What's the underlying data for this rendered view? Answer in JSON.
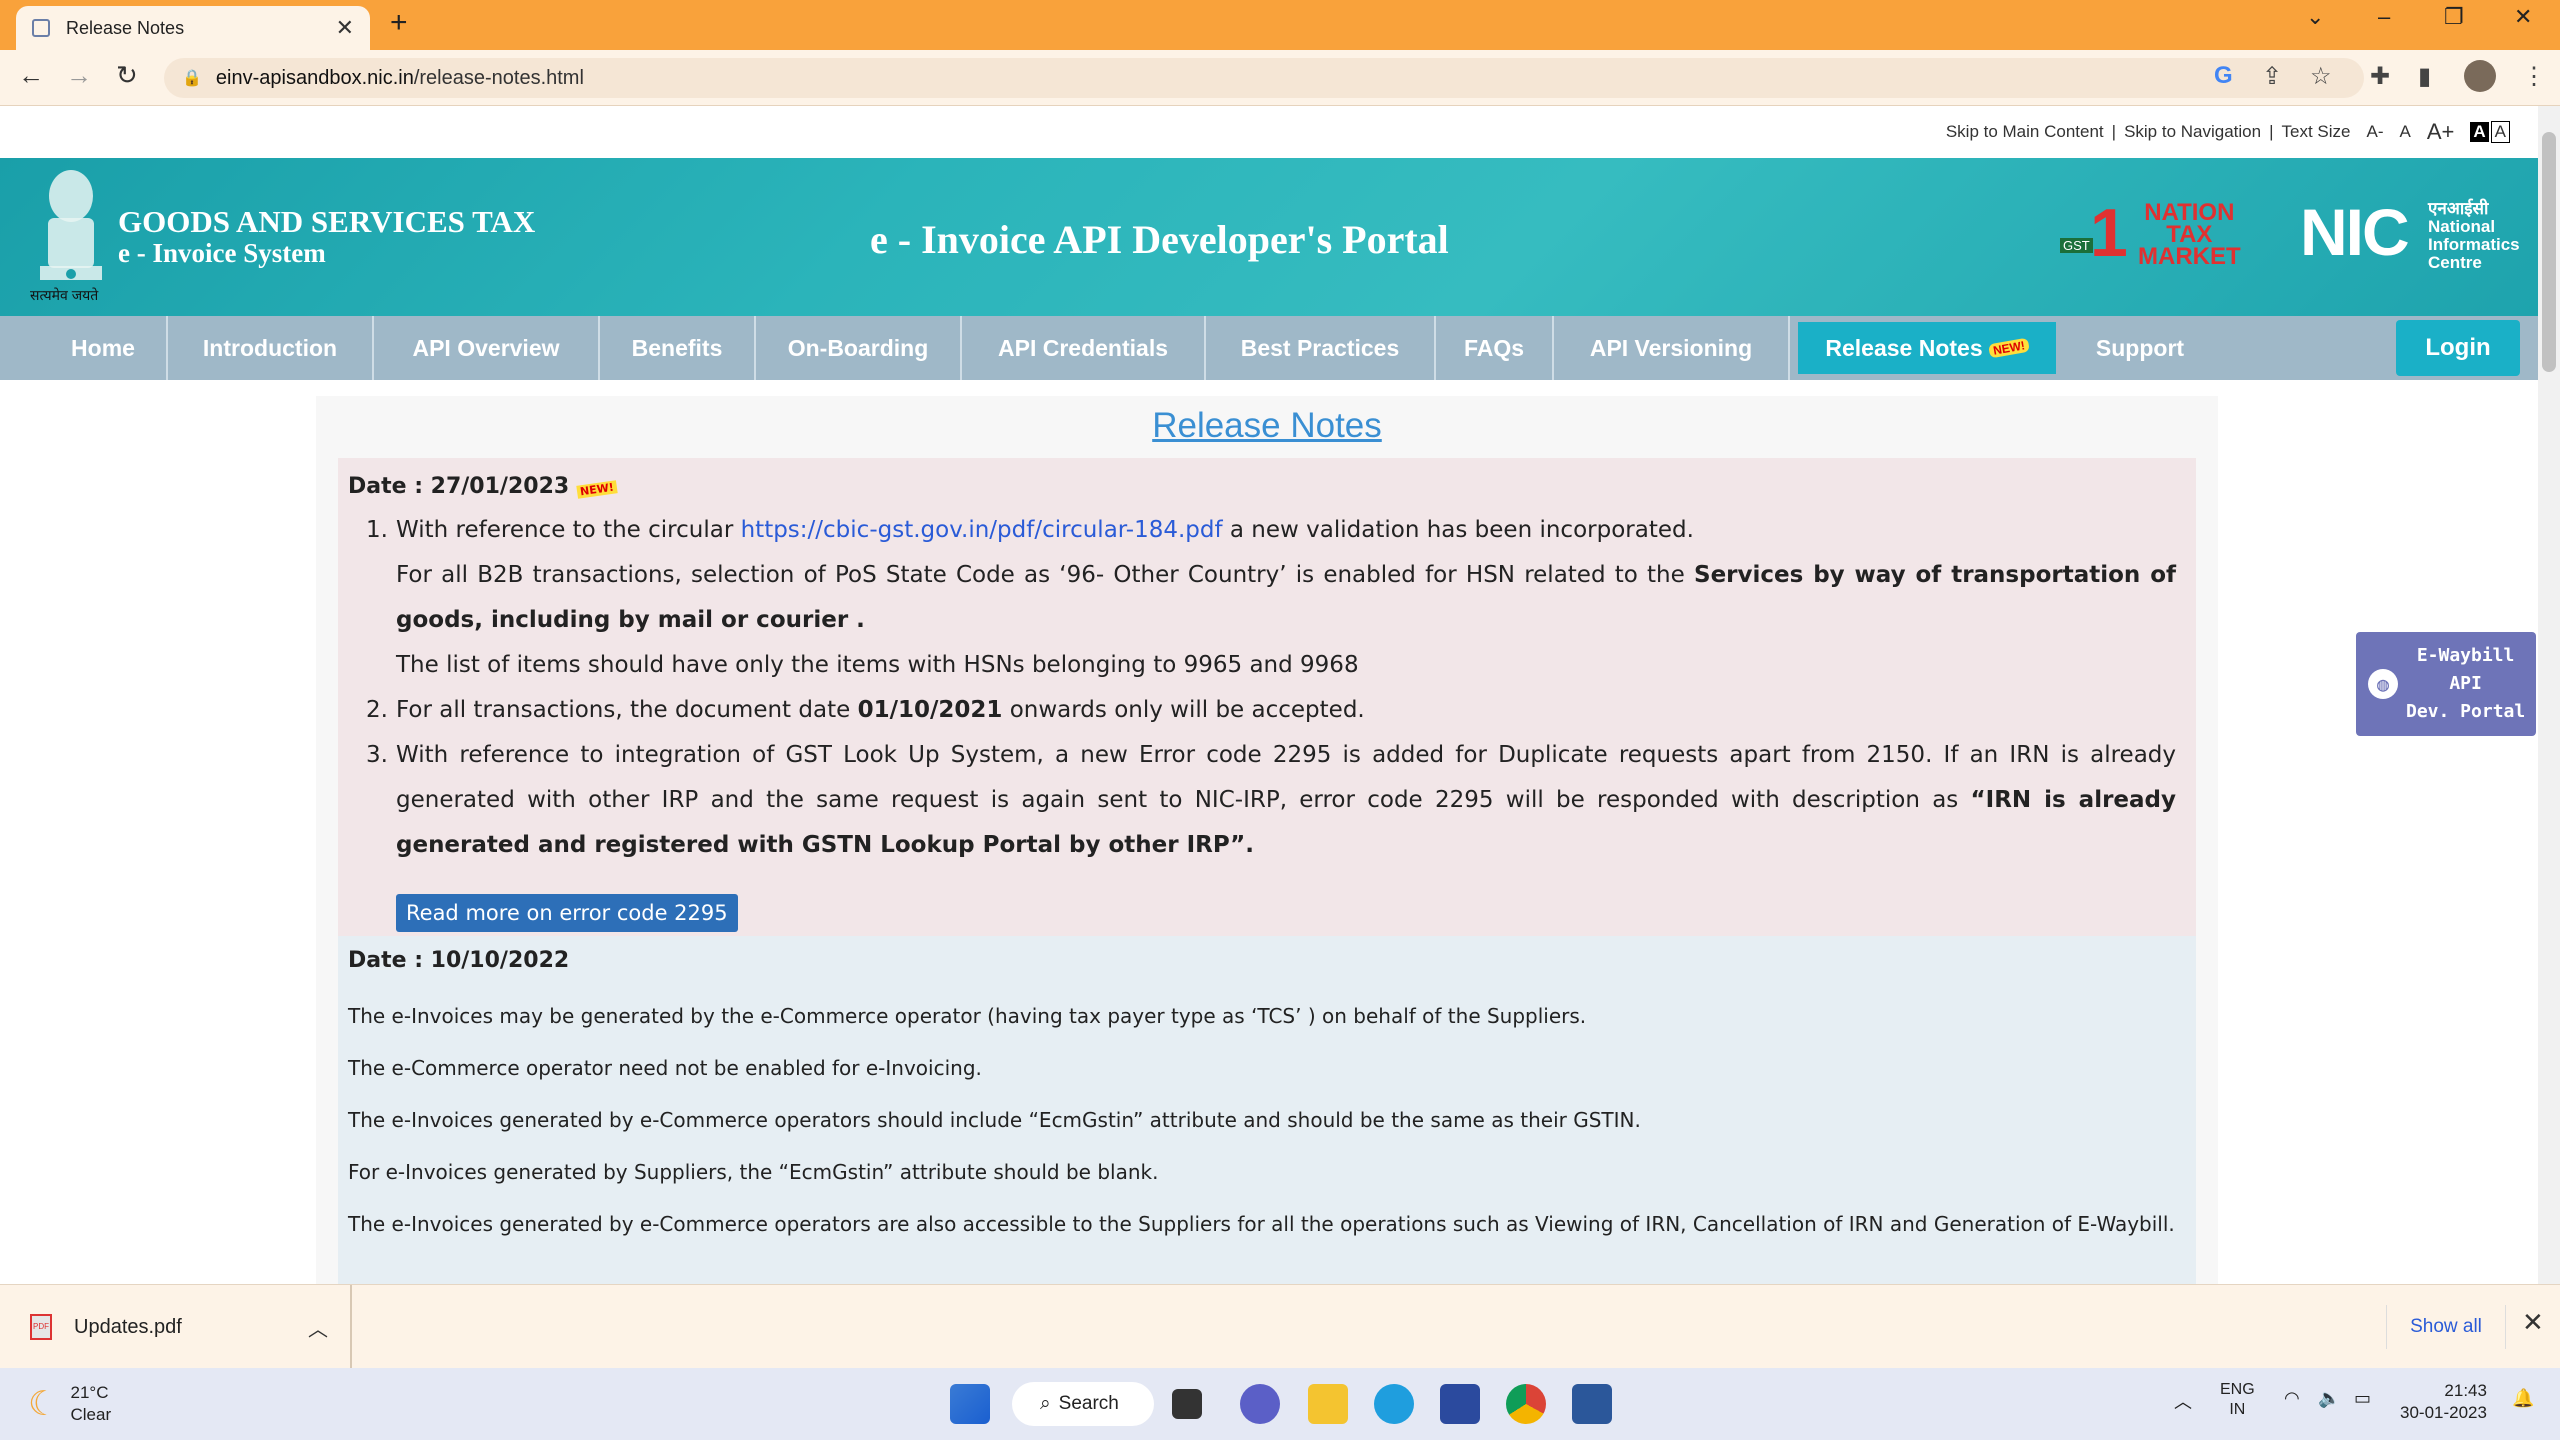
{
  "browser": {
    "tab_title": "Release Notes",
    "url_domain": "einv-apisandbox.nic.in",
    "url_path": "/release-notes.html"
  },
  "skip": {
    "main": "Skip to Main Content",
    "nav": "Skip to Navigation",
    "text_size": "Text Size",
    "a_minus": "A-",
    "a": "A",
    "a_plus": "A+"
  },
  "header": {
    "gst_title": "GOODS AND SERVICES TAX",
    "gst_sub": "e - Invoice System",
    "emblem_motto": "सत्यमेव जयते",
    "portal_title": "e - Invoice API Developer's Portal",
    "ntm_line1": "NATION",
    "ntm_line2": "TAX",
    "ntm_line3": "MARKET",
    "nic_logo": "NIC",
    "nic_hindi": "एनआईसी",
    "nic_line1": "National",
    "nic_line2": "Informatics",
    "nic_line3": "Centre"
  },
  "nav": {
    "items": [
      "Home",
      "Introduction",
      "API Overview",
      "Benefits",
      "On-Boarding",
      "API Credentials",
      "Best Practices",
      "FAQs",
      "API Versioning",
      "Release Notes",
      "Support"
    ],
    "new_tag": "NEW!",
    "login": "Login"
  },
  "content": {
    "title": "Release Notes",
    "section1": {
      "date": "Date : 27/01/2023",
      "new_badge": "NEW!",
      "item1_pre": "With reference to the circular ",
      "item1_link": "https://cbic-gst.gov.in/pdf/circular-184.pdf",
      "item1_post": " a new validation has been incorporated.",
      "item1_line2_pre": "For all B2B transactions, selection of PoS State Code as ‘96- Other Country’ is enabled for HSN related to the ",
      "item1_line2_bold": "Services by way of transportation of goods, including by mail or courier .",
      "item1_line3": "The list of items should have only the items with HSNs belonging to 9965 and 9968",
      "item2_pre": "For all transactions, the document date ",
      "item2_bold": "01/10/2021",
      "item2_post": " onwards only will be accepted.",
      "item3_pre": "With reference to integration of GST Look Up System, a new Error code 2295 is added for Duplicate requests apart from 2150. If an IRN is already generated with other IRP and the same request is again sent to NIC-IRP, error code 2295 will be responded with description as ",
      "item3_bold": "“IRN is already generated and registered with GSTN Lookup Portal by other IRP”.",
      "read_more": "Read more on error code 2295"
    },
    "section2": {
      "date": "Date : 10/10/2022",
      "paragraphs": [
        "The e-Invoices may be generated by the e-Commerce operator (having tax payer type as ‘TCS’ ) on behalf of the Suppliers.",
        "The e-Commerce operator need not be enabled for e-Invoicing.",
        "The e-Invoices generated by e-Commerce operators should include “EcmGstin” attribute and should be the same as their GSTIN.",
        "For e-Invoices generated by Suppliers, the “EcmGstin” attribute should be blank.",
        "The e-Invoices generated by e-Commerce operators are also accessible to the Suppliers for all the operations such as Viewing of IRN, Cancellation of IRN and Generation of E-Waybill."
      ]
    }
  },
  "ewaybill": {
    "line1": "E-Waybill",
    "line2": "API",
    "line3": "Dev. Portal"
  },
  "download": {
    "file": "Updates.pdf",
    "show_all": "Show all",
    "pdf_label": "PDF"
  },
  "taskbar": {
    "temp": "21°C",
    "weather": "Clear",
    "search": "Search",
    "lang1": "ENG",
    "lang2": "IN",
    "time": "21:43",
    "date": "30-01-2023"
  }
}
